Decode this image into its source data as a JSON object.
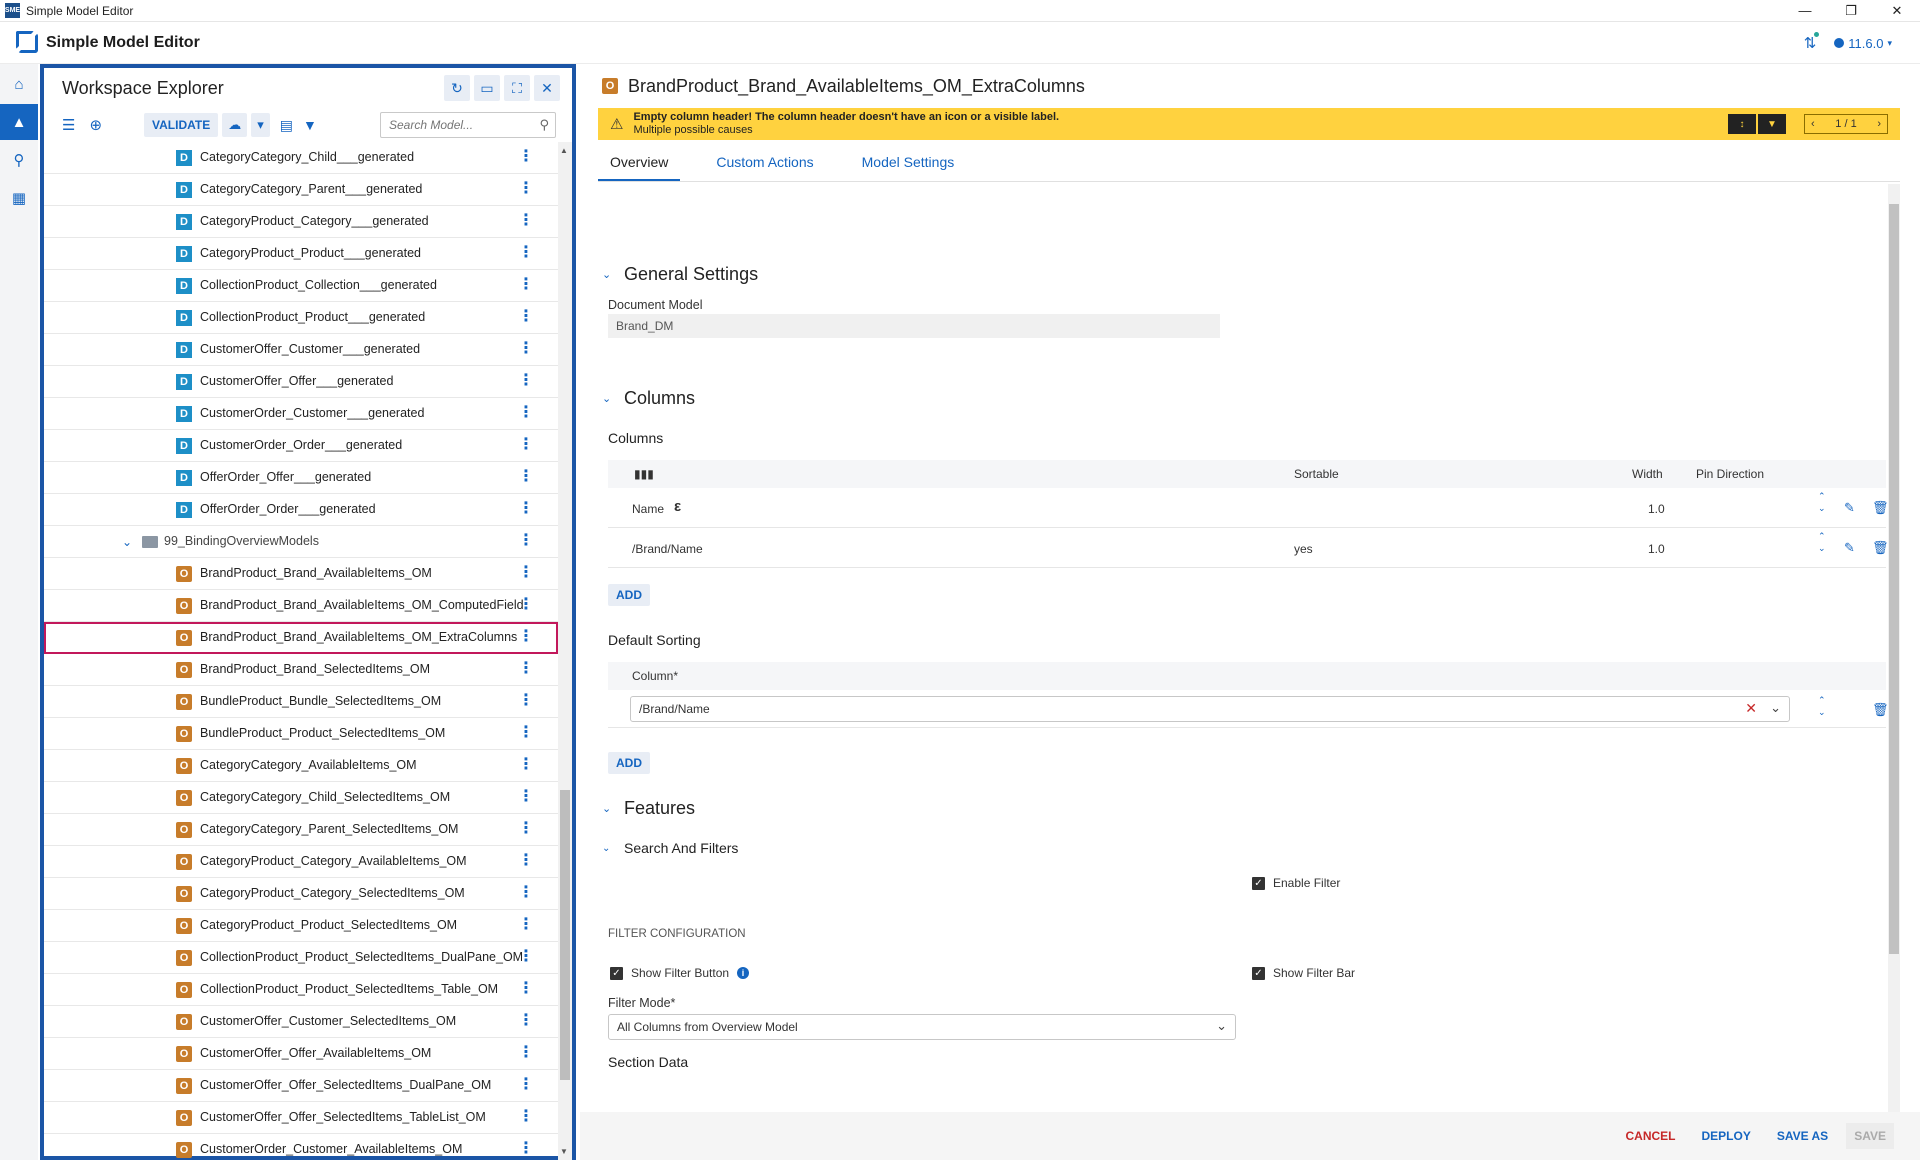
{
  "window": {
    "title": "Simple Model Editor",
    "app_icon": "SME"
  },
  "app": {
    "title": "Simple Model Editor",
    "version": "11.6.0"
  },
  "explorer": {
    "title": "Workspace Explorer",
    "validate_label": "VALIDATE",
    "search_placeholder": "Search Model...",
    "items": [
      {
        "type": "D",
        "label": "CategoryCategory_Child___generated"
      },
      {
        "type": "D",
        "label": "CategoryCategory_Parent___generated"
      },
      {
        "type": "D",
        "label": "CategoryProduct_Category___generated"
      },
      {
        "type": "D",
        "label": "CategoryProduct_Product___generated"
      },
      {
        "type": "D",
        "label": "CollectionProduct_Collection___generated"
      },
      {
        "type": "D",
        "label": "CollectionProduct_Product___generated"
      },
      {
        "type": "D",
        "label": "CustomerOffer_Customer___generated"
      },
      {
        "type": "D",
        "label": "CustomerOffer_Offer___generated"
      },
      {
        "type": "D",
        "label": "CustomerOrder_Customer___generated"
      },
      {
        "type": "D",
        "label": "CustomerOrder_Order___generated"
      },
      {
        "type": "D",
        "label": "OfferOrder_Offer___generated"
      },
      {
        "type": "D",
        "label": "OfferOrder_Order___generated"
      },
      {
        "type": "folder",
        "label": "99_BindingOverviewModels"
      },
      {
        "type": "O",
        "label": "BrandProduct_Brand_AvailableItems_OM"
      },
      {
        "type": "O",
        "label": "BrandProduct_Brand_AvailableItems_OM_ComputedField"
      },
      {
        "type": "O",
        "label": "BrandProduct_Brand_AvailableItems_OM_ExtraColumns",
        "selected": true
      },
      {
        "type": "O",
        "label": "BrandProduct_Brand_SelectedItems_OM"
      },
      {
        "type": "O",
        "label": "BundleProduct_Bundle_SelectedItems_OM"
      },
      {
        "type": "O",
        "label": "BundleProduct_Product_SelectedItems_OM"
      },
      {
        "type": "O",
        "label": "CategoryCategory_AvailableItems_OM"
      },
      {
        "type": "O",
        "label": "CategoryCategory_Child_SelectedItems_OM"
      },
      {
        "type": "O",
        "label": "CategoryCategory_Parent_SelectedItems_OM"
      },
      {
        "type": "O",
        "label": "CategoryProduct_Category_AvailableItems_OM"
      },
      {
        "type": "O",
        "label": "CategoryProduct_Category_SelectedItems_OM"
      },
      {
        "type": "O",
        "label": "CategoryProduct_Product_SelectedItems_OM"
      },
      {
        "type": "O",
        "label": "CollectionProduct_Product_SelectedItems_DualPane_OM"
      },
      {
        "type": "O",
        "label": "CollectionProduct_Product_SelectedItems_Table_OM"
      },
      {
        "type": "O",
        "label": "CustomerOffer_Customer_SelectedItems_OM"
      },
      {
        "type": "O",
        "label": "CustomerOffer_Offer_AvailableItems_OM"
      },
      {
        "type": "O",
        "label": "CustomerOffer_Offer_SelectedItems_DualPane_OM"
      },
      {
        "type": "O",
        "label": "CustomerOffer_Offer_SelectedItems_TableList_OM"
      },
      {
        "type": "O",
        "label": "CustomerOrder_Customer_AvailableItems_OM"
      }
    ]
  },
  "main": {
    "title": "BrandProduct_Brand_AvailableItems_OM_ExtraColumns",
    "warning": {
      "title": "Empty column header! The column header doesn't have an icon or a visible label.",
      "sub": "Multiple possible causes",
      "pager": "1 / 1"
    },
    "tabs": [
      "Overview",
      "Custom Actions",
      "Model Settings"
    ],
    "general": {
      "title": "General Settings",
      "doc_label": "Document Model",
      "doc_value": "Brand_DM"
    },
    "columns": {
      "title": "Columns",
      "sub": "Columns",
      "headers": {
        "sortable": "Sortable",
        "width": "Width",
        "pin": "Pin Direction"
      },
      "rows": [
        {
          "name": "Name",
          "icon": "ε",
          "sortable": "",
          "width": "1.0"
        },
        {
          "name": "/Brand/Name",
          "icon": "",
          "sortable": "yes",
          "width": "1.0"
        }
      ],
      "add": "ADD"
    },
    "sorting": {
      "title": "Default Sorting",
      "col_header": "Column*",
      "value": "/Brand/Name",
      "add": "ADD"
    },
    "features": {
      "title": "Features",
      "search_title": "Search And Filters",
      "enable_filter": "Enable Filter",
      "filter_config": "FILTER CONFIGURATION",
      "show_filter_button": "Show Filter Button",
      "show_filter_bar": "Show Filter Bar",
      "filter_mode_label": "Filter Mode*",
      "filter_mode_value": "All Columns from Overview Model",
      "section_data": "Section Data"
    },
    "footer": {
      "cancel": "CANCEL",
      "deploy": "DEPLOY",
      "save_as": "SAVE AS",
      "save": "SAVE"
    }
  }
}
